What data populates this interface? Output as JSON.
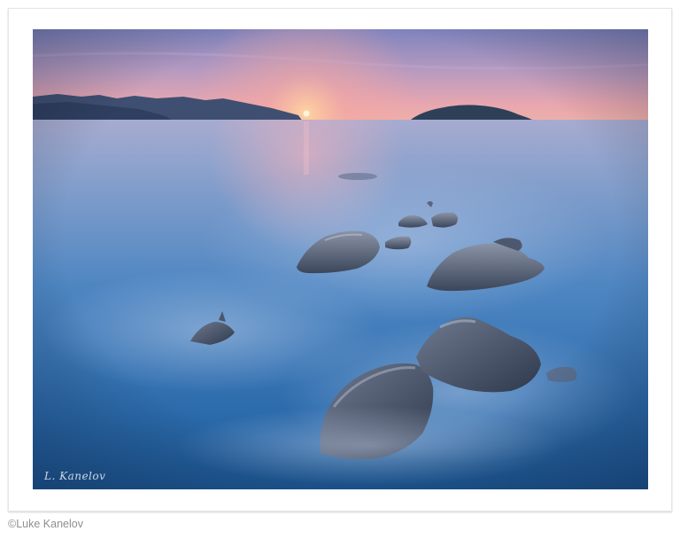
{
  "photo": {
    "signature": "L. Kanelov"
  },
  "credit": {
    "text": "©Luke Kanelov"
  },
  "colors": {
    "sky_top": "#8c8fc4",
    "sky_glow": "#f0a7a0",
    "sea_far": "#8ea5cf",
    "sea_near": "#1f5f9e",
    "rocks": "#4f5a6b",
    "frame": "#ffffff"
  }
}
